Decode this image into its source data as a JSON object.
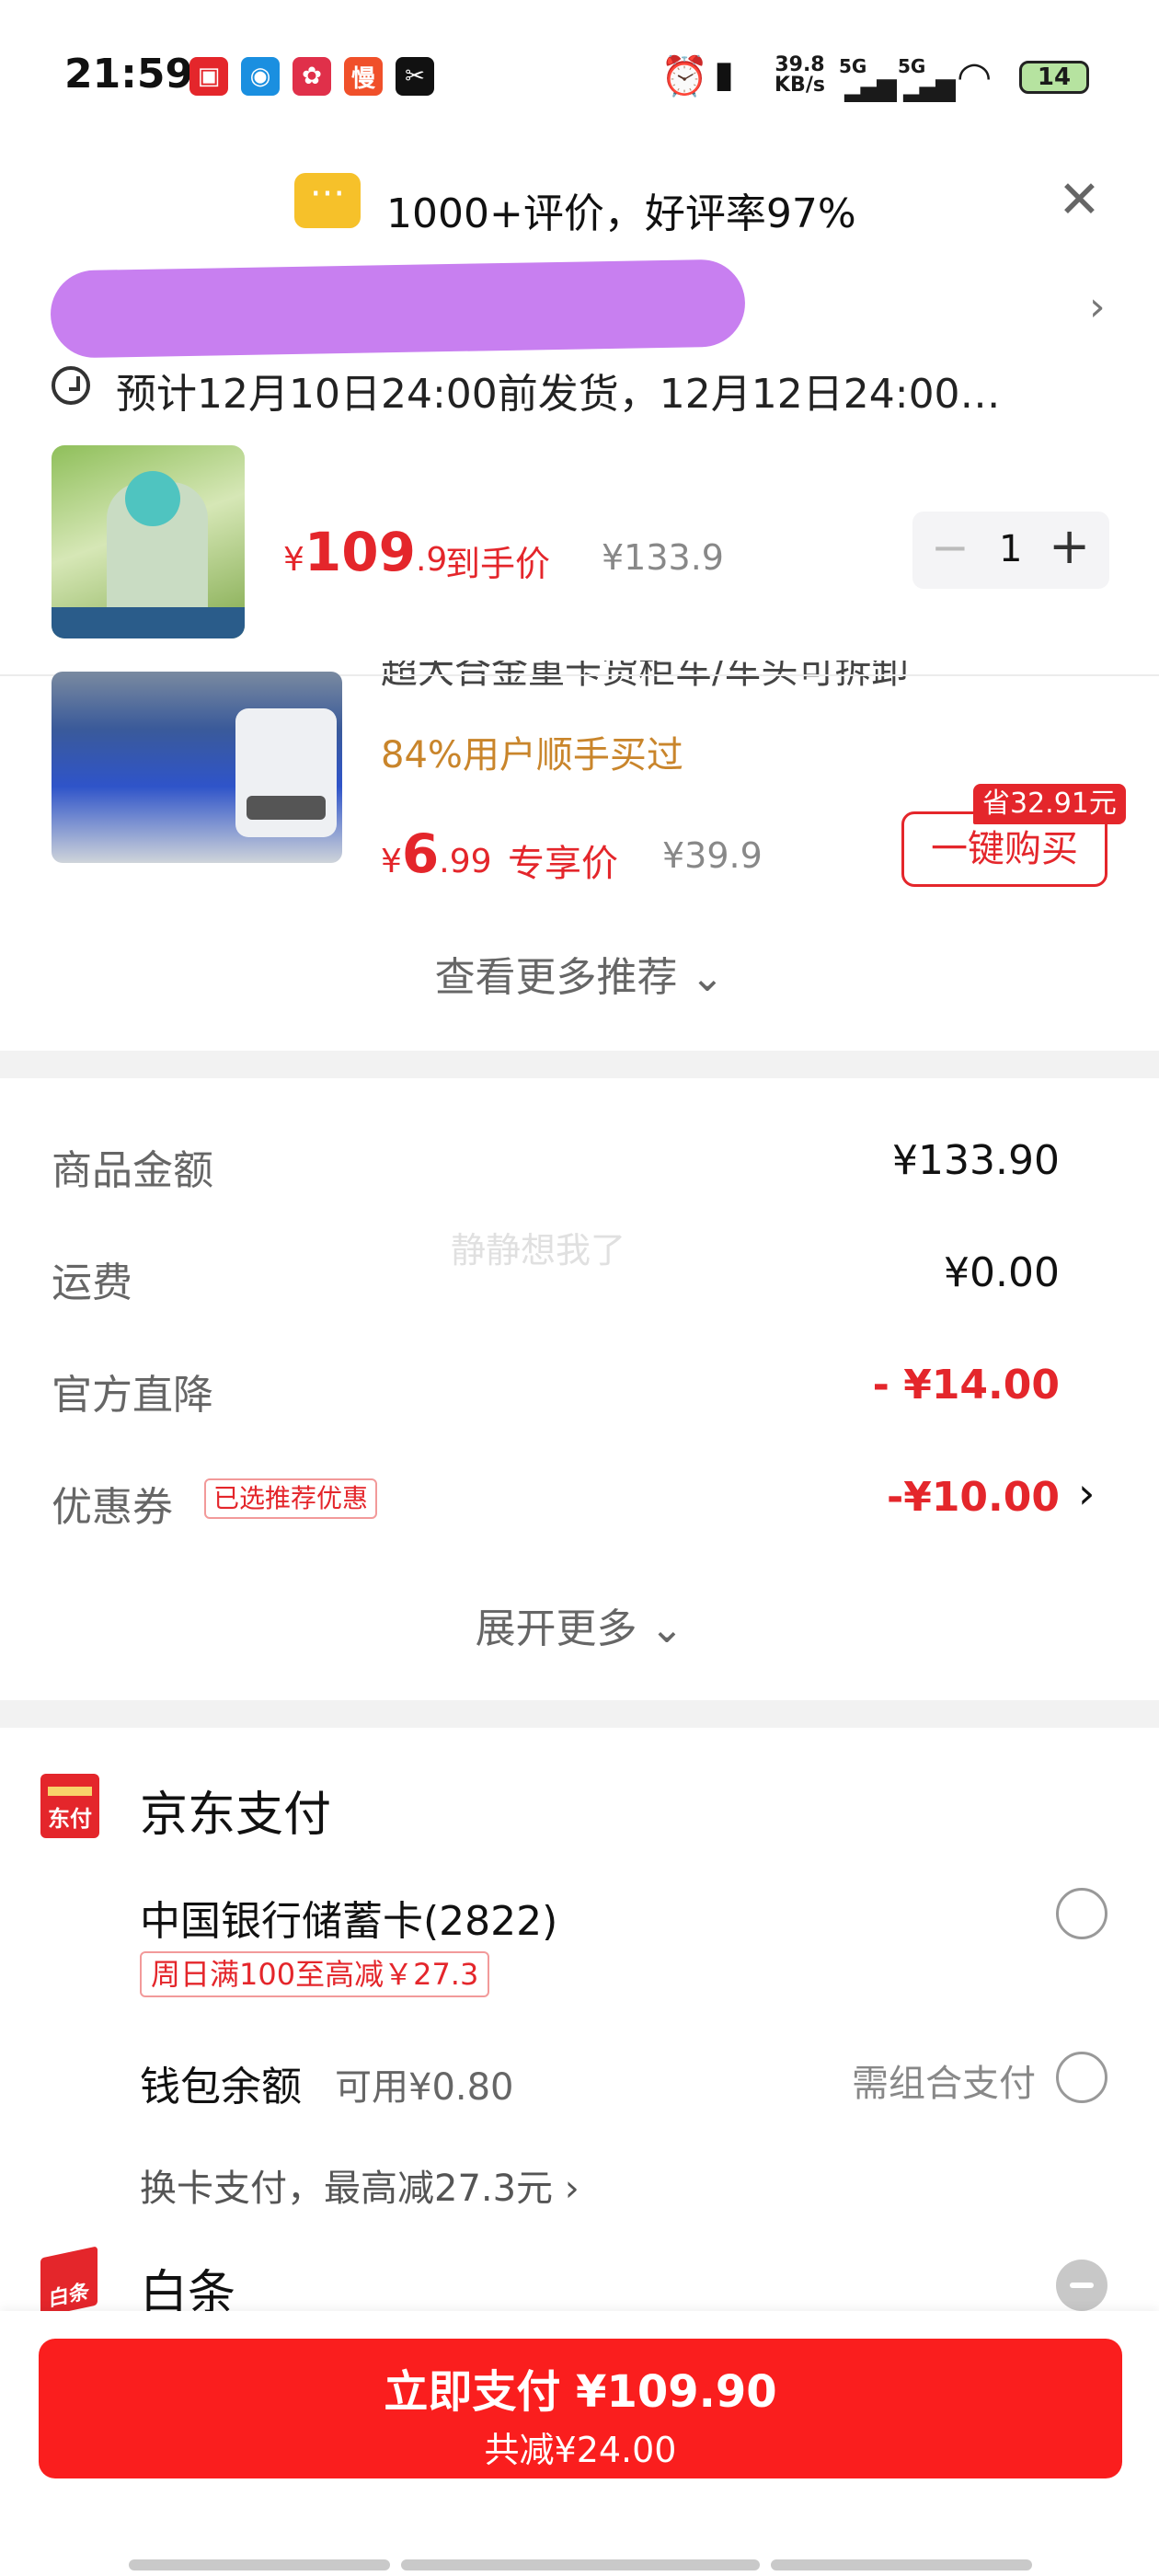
{
  "status_bar": {
    "time": "21:59",
    "net_speed": "39.8",
    "net_unit": "KB/s",
    "sig1": "5G",
    "sig2": "5G",
    "battery": "14",
    "app_icons": [
      "jd-icon",
      "robot-icon",
      "gift-icon",
      "man-icon",
      "capcut-icon"
    ]
  },
  "review": {
    "text": "1000+评价，好评率97%"
  },
  "shipping": {
    "text": "预计12月10日24:00前发货，12月12日24:00…"
  },
  "item1": {
    "currency": "¥",
    "price_int": "109",
    "price_dec": ".9",
    "price_label": "到手价",
    "orig_price": "¥133.9",
    "qty": "1",
    "minus": "−",
    "plus": "+"
  },
  "item2": {
    "title_cut": "超大合金重卡货柜车/车头可拆卸",
    "subtitle": "84%用户顺手买过",
    "currency": "¥",
    "price_int": "6",
    "price_dec": ".99",
    "price_label": "专享价",
    "orig_price": "¥39.9",
    "save_badge": "省32.91元",
    "buy_label": "一键购买"
  },
  "more_recommend": "查看更多推荐 ⌄",
  "summary": {
    "rows": [
      {
        "label": "商品金额",
        "value": "¥133.90"
      },
      {
        "label": "运费",
        "value": "¥0.00"
      },
      {
        "label": "官方直降",
        "value": "- ¥14.00"
      },
      {
        "label": "优惠券",
        "value": "-¥10.00"
      }
    ],
    "coupon_tag": "已选推荐优惠",
    "watermark": "静静想我了",
    "expand_label": "展开更多 ⌄"
  },
  "payment": {
    "jd_title": "京东支付",
    "jd_logo_label": "东付",
    "bank_card": "中国银行储蓄卡(2822)",
    "bank_promo": "周日满100至高减￥27.3",
    "wallet_label": "钱包余额",
    "wallet_avail": "可用¥0.80",
    "wallet_note": "需组合支付",
    "switch_card": "换卡支付，最高减27.3元 ›",
    "baitiao_title": "白条",
    "baitiao_logo": "白条"
  },
  "checkout": {
    "pay_label": "立即支付 ¥109.90",
    "total_saved": "共减¥24.00"
  },
  "colors": {
    "accent_red": "#e4262b",
    "button_red": "#fa1e1e",
    "review_yellow": "#f6c12a",
    "orange_text": "#c9852b"
  }
}
